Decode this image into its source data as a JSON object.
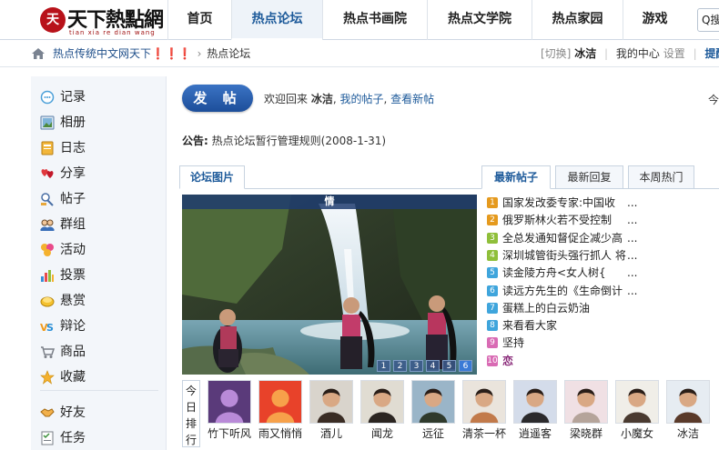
{
  "logo": {
    "seal": "天",
    "brand": "天下熱點網",
    "sub": "tian xia re dian wang"
  },
  "nav": [
    "首页",
    "热点论坛",
    "热点书画院",
    "热点文学院",
    "热点家园",
    "游戏"
  ],
  "search": {
    "label": "Q搜"
  },
  "breadcrumb": {
    "site": "热点传统中文网天下❗❗❗",
    "sep": "›",
    "current": "热点论坛"
  },
  "user": {
    "switch": "[切换]",
    "name": "冰洁",
    "center": "我的中心",
    "settings": "设置",
    "remind": "提醒"
  },
  "sidebar": [
    "记录",
    "相册",
    "日志",
    "分享",
    "帖子",
    "群组",
    "活动",
    "投票",
    "悬赏",
    "辩论",
    "商品",
    "收藏",
    "好友",
    "任务"
  ],
  "post_button": "发 帖",
  "welcome": {
    "prefix": "欢迎回来",
    "name": "冰洁",
    "my_posts": "我的帖子",
    "new_posts": "查看新帖"
  },
  "today_prefix": "今",
  "notice": {
    "label": "公告:",
    "text": "热点论坛暂行管理规则(2008-1-31)"
  },
  "tabs": {
    "pictures": "论坛图片",
    "latest": "最新帖子",
    "replies": "最新回复",
    "weekly": "本周热门"
  },
  "slide": {
    "caption": "情",
    "pages": [
      "1",
      "2",
      "3",
      "4",
      "5",
      "6"
    ],
    "active_page": 6
  },
  "posts": [
    {
      "n": "1",
      "title": "国家发改委专家:中国收",
      "dots": "...",
      "color": "#e59a1e"
    },
    {
      "n": "2",
      "title": "俄罗斯林火若不受控制",
      "dots": "...",
      "color": "#e59a1e"
    },
    {
      "n": "3",
      "title": "全总发通知督促企减少高",
      "dots": "...",
      "color": "#8fbf3a"
    },
    {
      "n": "4",
      "title": "深圳城管街头强行抓人 将",
      "dots": "...",
      "color": "#8fbf3a"
    },
    {
      "n": "5",
      "title": "读金陵方舟<女人树{",
      "dots": "...",
      "color": "#3fa5dc"
    },
    {
      "n": "6",
      "title": "读远方先生的《生命倒计",
      "dots": "...",
      "color": "#3fa5dc"
    },
    {
      "n": "7",
      "title": "蛋糕上的白云奶油",
      "dots": "",
      "color": "#3fa5dc"
    },
    {
      "n": "8",
      "title": "来看看大家",
      "dots": "",
      "color": "#3fa5dc"
    },
    {
      "n": "9",
      "title": "坚持",
      "dots": "",
      "color": "#d96bb4"
    },
    {
      "n": "10",
      "title": "恋",
      "dots": "",
      "color": "#d96bb4"
    }
  ],
  "ranking": {
    "label": "今日排行",
    "users": [
      "竹下听风",
      "雨又悄悄",
      "酒儿",
      "闻龙",
      "远征",
      "清茶一杯",
      "逍遥客",
      "梁晓群",
      "小魔女",
      "冰洁"
    ]
  }
}
